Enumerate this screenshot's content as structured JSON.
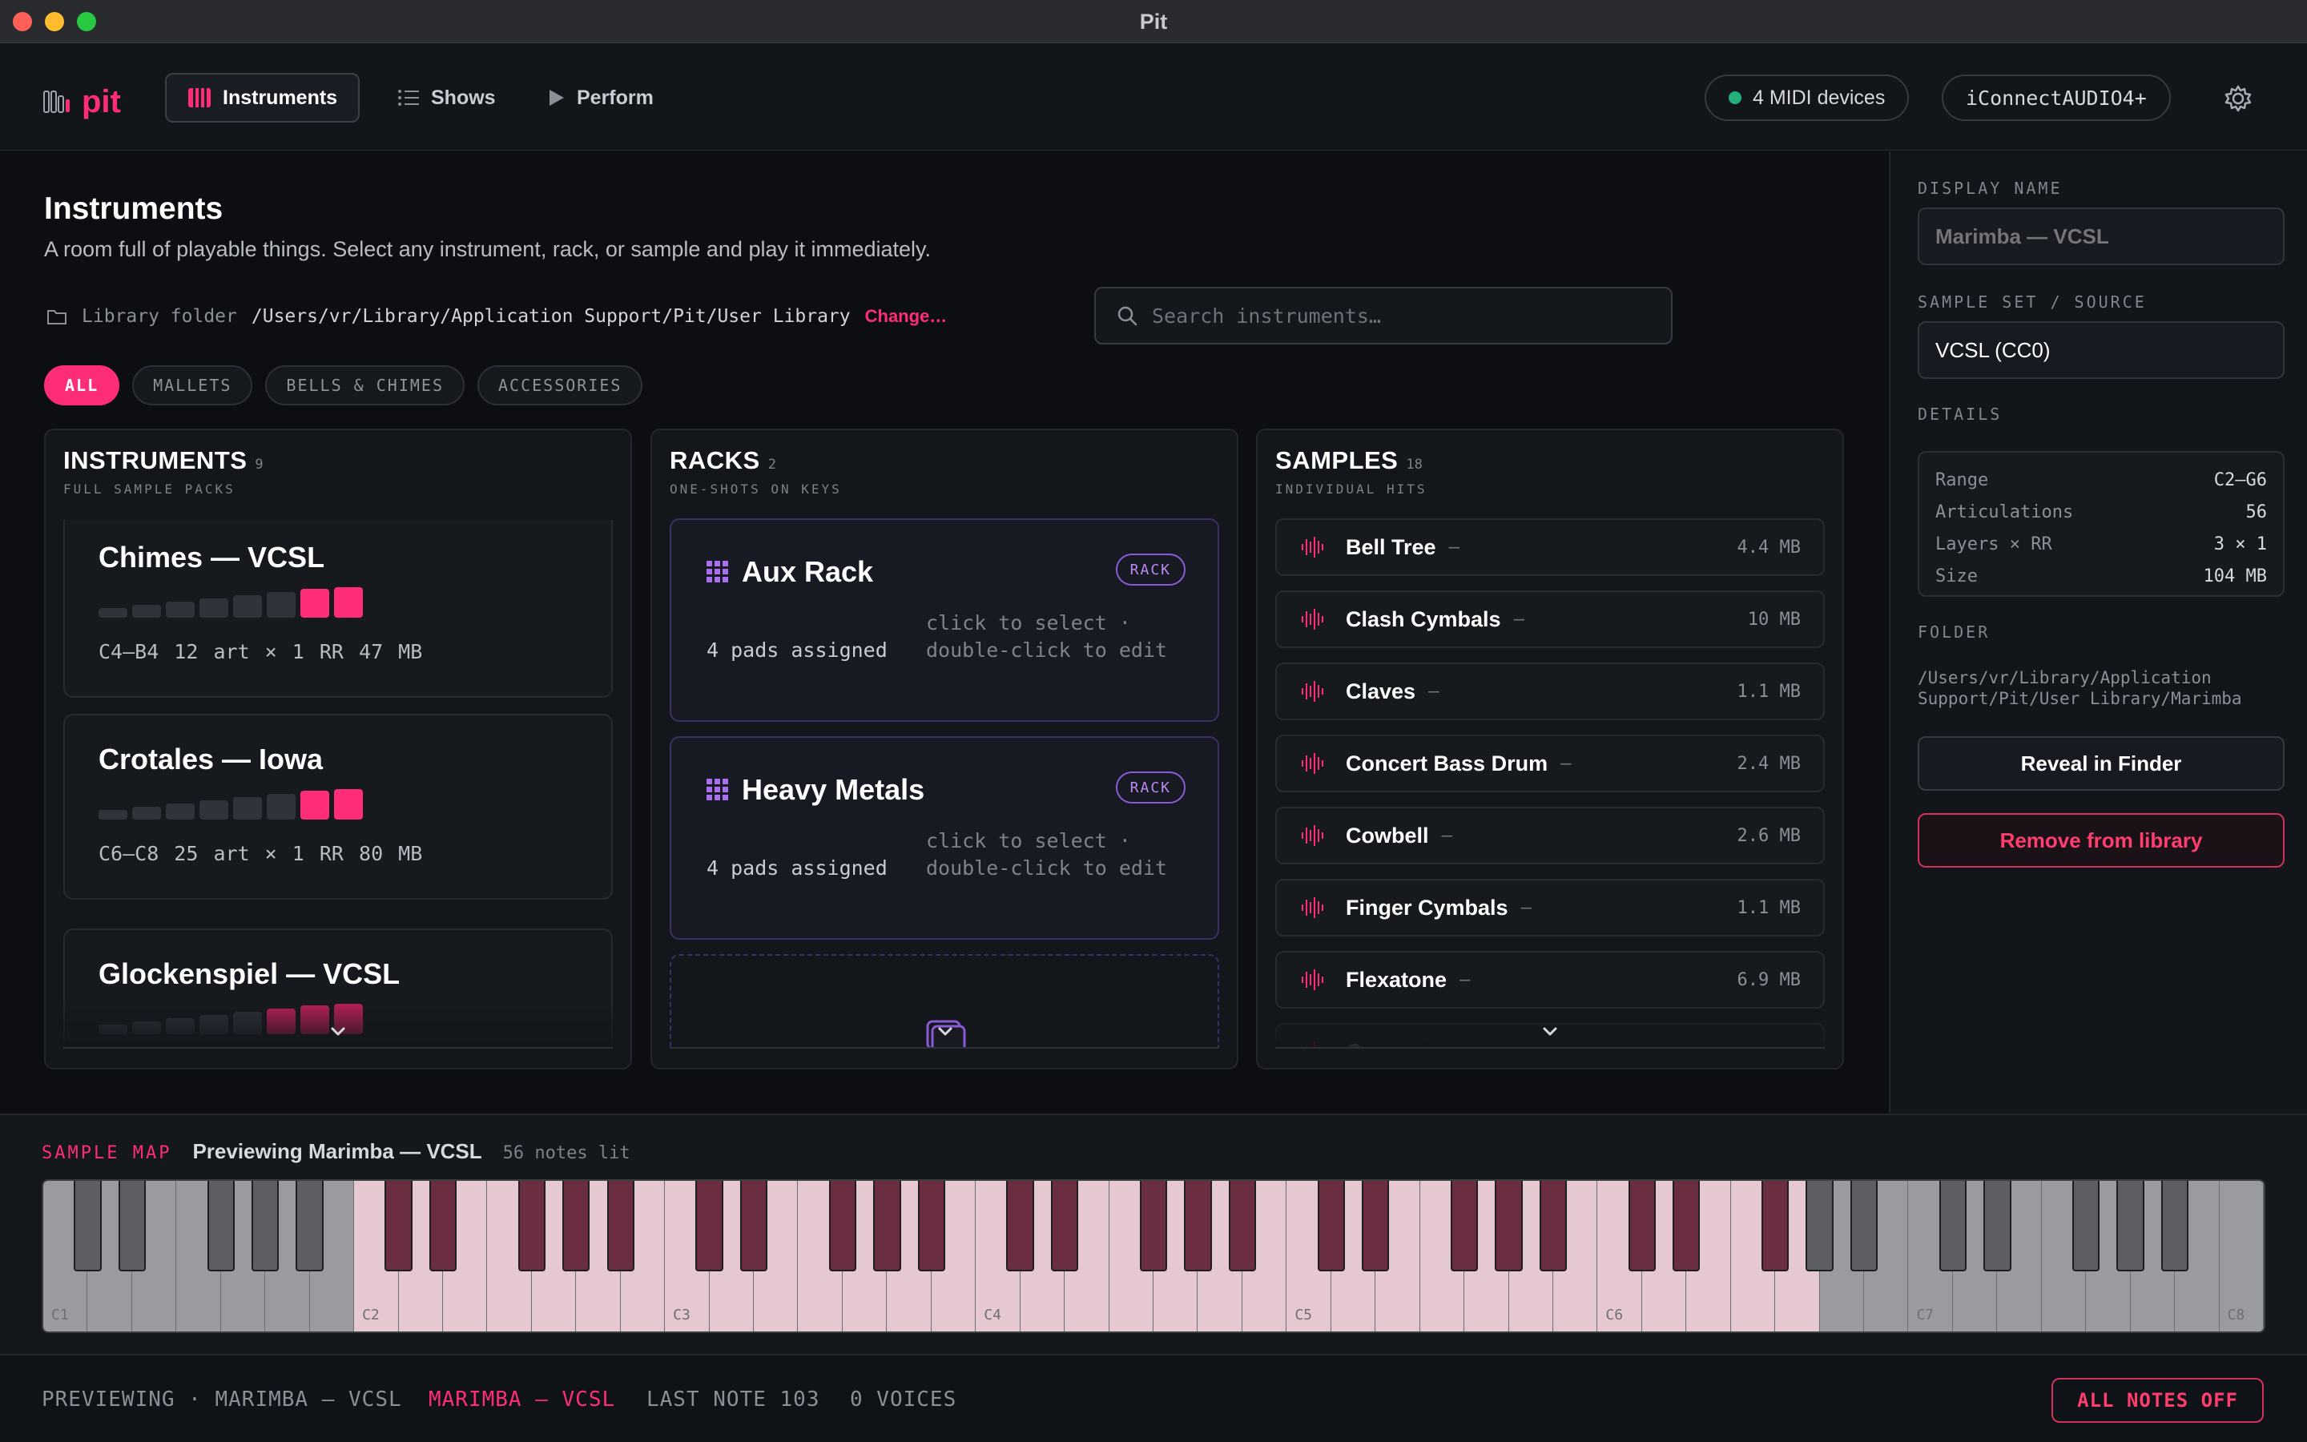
{
  "window": {
    "title": "Pit"
  },
  "header": {
    "logo_text": "pit",
    "nav": [
      {
        "label": "Instruments",
        "icon": "piano-icon",
        "active": true
      },
      {
        "label": "Shows",
        "icon": "list-icon",
        "active": false
      },
      {
        "label": "Perform",
        "icon": "play-icon",
        "active": false
      }
    ],
    "midi_label": "4 MIDI devices",
    "audio_device": "iConnectAUDIO4+",
    "settings_icon": "gear-icon"
  },
  "main": {
    "title": "Instruments",
    "subtitle": "A room full of playable things. Select any instrument, rack, or sample and play it immediately.",
    "library_label": "Library folder",
    "library_path": "/Users/vr/Library/Application Support/Pit/User Library",
    "library_change": "Change…",
    "search_placeholder": "Search instruments…",
    "filters": [
      "ALL",
      "MALLETS",
      "BELLS & CHIMES",
      "ACCESSORIES"
    ],
    "active_filter": "ALL"
  },
  "instruments": {
    "title": "INSTRUMENTS",
    "count": "9",
    "subtitle": "FULL SAMPLE PACKS",
    "items": [
      {
        "name": "Chimes — VCSL",
        "meta": "C4–B4  12 art × 1 RR  47 MB"
      },
      {
        "name": "Crotales — Iowa",
        "meta": "C6–C8  25 art × 1 RR  80 MB"
      },
      {
        "name": "Glockenspiel — VCSL",
        "meta": ""
      }
    ]
  },
  "racks": {
    "title": "RACKS",
    "count": "2",
    "subtitle": "ONE-SHOTS ON KEYS",
    "badge": "RACK",
    "hint": "click to select · double-click to edit",
    "items": [
      {
        "name": "Aux Rack",
        "pads": "4 pads assigned"
      },
      {
        "name": "Heavy Metals",
        "pads": "4 pads assigned"
      }
    ]
  },
  "samples": {
    "title": "SAMPLES",
    "count": "18",
    "subtitle": "INDIVIDUAL HITS",
    "items": [
      {
        "name": "Bell Tree",
        "size": "4.4 MB"
      },
      {
        "name": "Clash Cymbals",
        "size": "10 MB"
      },
      {
        "name": "Claves",
        "size": "1.1 MB"
      },
      {
        "name": "Concert Bass Drum",
        "size": "2.4 MB"
      },
      {
        "name": "Cowbell",
        "size": "2.6 MB"
      },
      {
        "name": "Finger Cymbals",
        "size": "1.1 MB"
      },
      {
        "name": "Flexatone",
        "size": "6.9 MB"
      },
      {
        "name": "Gong",
        "size": ""
      }
    ],
    "dash": "–"
  },
  "inspector": {
    "display_name_label": "DISPLAY NAME",
    "display_name_placeholder": "Marimba — VCSL",
    "source_label": "SAMPLE SET / SOURCE",
    "source_value": "VCSL (CC0)",
    "details_label": "DETAILS",
    "details": [
      {
        "key": "Range",
        "value": "C2–G6"
      },
      {
        "key": "Articulations",
        "value": "56"
      },
      {
        "key": "Layers × RR",
        "value": "3 × 1"
      },
      {
        "key": "Size",
        "value": "104 MB"
      }
    ],
    "folder_label": "FOLDER",
    "folder_path": "/Users/vr/Library/Application Support/Pit/User Library/Marimba",
    "reveal_label": "Reveal in Finder",
    "remove_label": "Remove from library"
  },
  "sample_map": {
    "tag": "SAMPLE MAP",
    "title": "Previewing Marimba — VCSL",
    "count": "56 notes lit",
    "octave_labels": [
      "C1",
      "C2",
      "C3",
      "C4",
      "C5",
      "C6",
      "C7",
      "C8"
    ],
    "lit_range_note": "C2–G6"
  },
  "status": {
    "previewing": "PREVIEWING · MARIMBA — VCSL",
    "current": "MARIMBA — VCSL",
    "last_note": "LAST NOTE 103",
    "voices": "0 VOICES",
    "all_notes_off": "ALL NOTES OFF"
  },
  "colors": {
    "accent": "#ff2d78",
    "rack_accent": "#8a5ad6",
    "midi_dot": "#23b07a"
  }
}
